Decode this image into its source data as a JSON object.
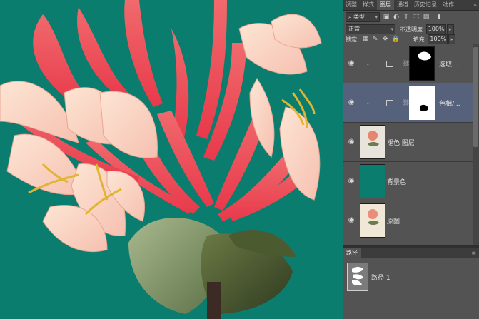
{
  "panel": {
    "tabs": [
      "调整",
      "样式",
      "图层",
      "通道",
      "历史记录",
      "动作"
    ],
    "active_tab": "图层",
    "tab_more": "»",
    "filter_kind": "类型",
    "blend_mode": "正常",
    "opacity_label": "不透明度:",
    "opacity_value": "100%",
    "lock_label": "锁定:",
    "fill_label": "填充:",
    "fill_value": "100%"
  },
  "layers": [
    {
      "name": "选取...",
      "type": "adjustment"
    },
    {
      "name": "色相/...",
      "type": "adjustment"
    },
    {
      "name": "褪色 图层",
      "type": "pixel"
    },
    {
      "name": "背景色",
      "type": "fill"
    },
    {
      "name": "原图",
      "type": "pixel"
    }
  ],
  "paths_panel": {
    "tab": "路径",
    "menu": "≡",
    "items": [
      {
        "name": "路径 1"
      }
    ]
  },
  "colors": {
    "canvas_bg": "#0b7d6e",
    "panel_bg": "#535353",
    "selected_layer": "#56627b"
  }
}
